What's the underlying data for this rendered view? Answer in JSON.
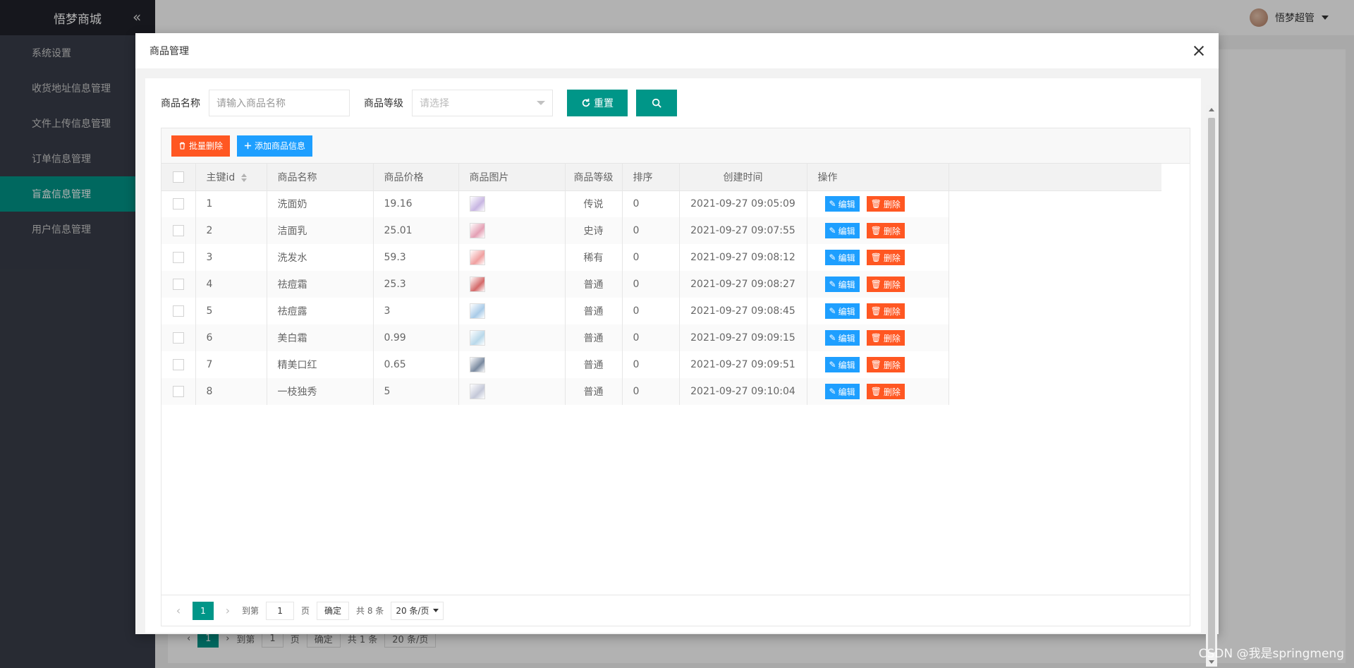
{
  "sidebar": {
    "title": "悟梦商城",
    "items": [
      {
        "label": "系统设置"
      },
      {
        "label": "收货地址信息管理"
      },
      {
        "label": "文件上传信息管理"
      },
      {
        "label": "订单信息管理"
      },
      {
        "label": "盲盒信息管理"
      },
      {
        "label": "用户信息管理"
      }
    ],
    "active_index": 4
  },
  "header": {
    "username": "悟梦超管"
  },
  "bg_pager": {
    "page": "1",
    "goto_label": "到第",
    "goto_value": "1",
    "page_unit": "页",
    "confirm": "确定",
    "total": "共 1 条",
    "per_page": "20 条/页"
  },
  "modal": {
    "title": "商品管理",
    "search": {
      "name_label": "商品名称",
      "name_placeholder": "请输入商品名称",
      "level_label": "商品等级",
      "level_placeholder": "请选择",
      "reset_label": "重置"
    },
    "toolbar": {
      "batch_delete": "批量删除",
      "add": "添加商品信息"
    },
    "table": {
      "headers": [
        "主键id",
        "商品名称",
        "商品价格",
        "商品图片",
        "商品等级",
        "排序",
        "创建时间",
        "操作"
      ],
      "rows": [
        {
          "id": "1",
          "name": "洗面奶",
          "price": "19.16",
          "level": "传说",
          "sort": "0",
          "time": "2021-09-27 09:05:09"
        },
        {
          "id": "2",
          "name": "洁面乳",
          "price": "25.01",
          "level": "史诗",
          "sort": "0",
          "time": "2021-09-27 09:07:55"
        },
        {
          "id": "3",
          "name": "洗发水",
          "price": "59.3",
          "level": "稀有",
          "sort": "0",
          "time": "2021-09-27 09:08:12"
        },
        {
          "id": "4",
          "name": "祛痘霜",
          "price": "25.3",
          "level": "普通",
          "sort": "0",
          "time": "2021-09-27 09:08:27"
        },
        {
          "id": "5",
          "name": "祛痘露",
          "price": "3",
          "level": "普通",
          "sort": "0",
          "time": "2021-09-27 09:08:45"
        },
        {
          "id": "6",
          "name": "美白霜",
          "price": "0.99",
          "level": "普通",
          "sort": "0",
          "time": "2021-09-27 09:09:15"
        },
        {
          "id": "7",
          "name": "精美口红",
          "price": "0.65",
          "level": "普通",
          "sort": "0",
          "time": "2021-09-27 09:09:51"
        },
        {
          "id": "8",
          "name": "一枝独秀",
          "price": "5",
          "level": "普通",
          "sort": "0",
          "time": "2021-09-27 09:10:04"
        }
      ],
      "edit_label": "编辑",
      "delete_label": "删除"
    },
    "pager": {
      "page": "1",
      "goto_label": "到第",
      "goto_value": "1",
      "page_unit": "页",
      "confirm": "确定",
      "total": "共 8 条",
      "per_page": "20 条/页"
    }
  },
  "watermark": "CSDN @我是springmeng",
  "colors": {
    "teal": "#009688",
    "blue": "#1e9fff",
    "red": "#ff5722",
    "sidebar": "#393d49"
  }
}
